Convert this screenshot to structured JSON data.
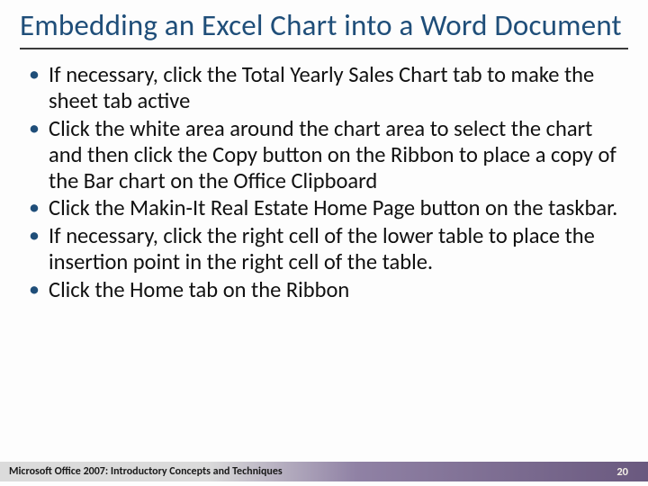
{
  "title": "Embedding an Excel Chart into a Word Document",
  "bullets": [
    "If necessary, click the Total Yearly Sales Chart tab to make the sheet tab active",
    "Click the white area around the chart area to select the chart and then click the Copy button on the Ribbon to place a copy of the Bar chart on the Office Clipboard",
    "Click the Makin-It Real Estate Home Page button on the taskbar.",
    "If necessary, click the right cell of the lower table to place the insertion point in the right cell of the table.",
    "Click the Home tab on the Ribbon"
  ],
  "footer": {
    "text": "Microsoft Office 2007: Introductory Concepts and Techniques",
    "page": "20"
  }
}
